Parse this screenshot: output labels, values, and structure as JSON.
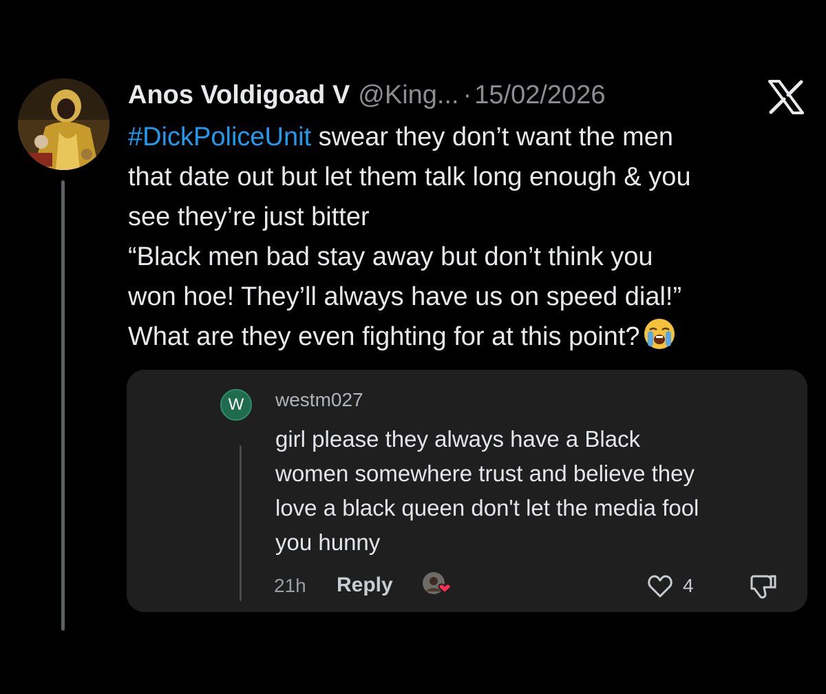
{
  "tweet": {
    "display_name": "Anos Voldigoad V",
    "handle": "@King...",
    "separator": "·",
    "date": "15/02/2026",
    "hashtag": "#DickPoliceUnit",
    "line1_rest": " swear they don’t want the men",
    "line2": "that date out but let them talk long enough & you",
    "line3": "see they’re just bitter",
    "line4": "“Black men bad stay away but don’t think you",
    "line5": "won hoe! They’ll always have us on speed dial!”",
    "line6": "What are they even fighting for at this point?",
    "emoji": "loudly-crying-face-icon",
    "logo": "x-logo-icon"
  },
  "comment": {
    "avatar_letter": "W",
    "username": "westm027",
    "lines": [
      "girl please they always have a Black",
      "women somewhere trust and believe they",
      "love a black queen don't let the media fool",
      "you hunny"
    ],
    "time": "21h",
    "reply_label": "Reply",
    "likes": "4"
  },
  "colors": {
    "background": "#000000",
    "hashtag": "#1d9bf0",
    "card": "#1f1f1f",
    "comment_avatar": "#1f6b4f"
  }
}
